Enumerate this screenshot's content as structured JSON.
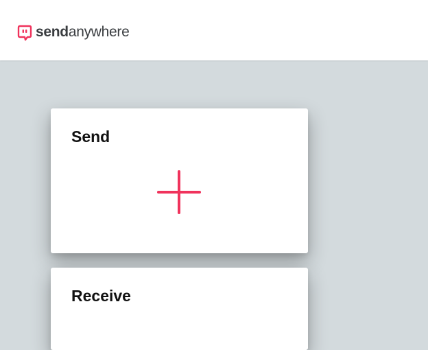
{
  "header": {
    "logo": {
      "text_bold": "send",
      "text_light": "anywhere",
      "icon": "send-anywhere-logo-icon",
      "color": "#f0335c"
    }
  },
  "send_card": {
    "title": "Send",
    "add_icon": "plus-icon",
    "accent_color": "#f0335c"
  },
  "receive_card": {
    "title": "Receive"
  },
  "colors": {
    "background": "#d3dadd",
    "card": "#ffffff",
    "accent": "#f0335c"
  }
}
